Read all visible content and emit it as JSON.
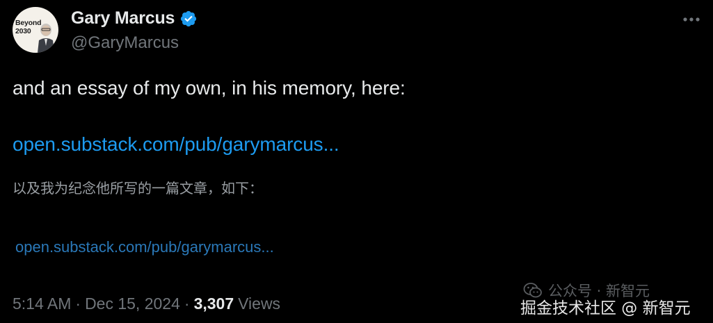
{
  "author": {
    "display_name": "Gary Marcus",
    "handle": "@GaryMarcus",
    "avatar_text_line1": "Beyond",
    "avatar_text_line2": "2030",
    "verified_icon": "verified-badge-icon",
    "verified_color": "#1d9bf0"
  },
  "tweet": {
    "text": "and an essay of my own, in his memory, here:",
    "link": "open.substack.com/pub/garymarcus...",
    "translation": "以及我为纪念他所写的一篇文章，如下：",
    "translated_link": "open.substack.com/pub/garymarcus..."
  },
  "meta": {
    "time": "5:14 AM",
    "separator": "·",
    "date": "Dec 15, 2024",
    "separator2": "·",
    "views_count": "3,307",
    "views_label": "Views"
  },
  "watermarks": {
    "wechat": "公众号 · 新智元",
    "juejin": "掘金技术社区 @ 新智元"
  },
  "colors": {
    "background": "#000000",
    "primary_text": "#e7e9ea",
    "secondary_text": "#71767b",
    "link": "#1d9bf0"
  },
  "icons": {
    "more": "more-horizontal-icon",
    "wechat": "wechat-icon"
  }
}
